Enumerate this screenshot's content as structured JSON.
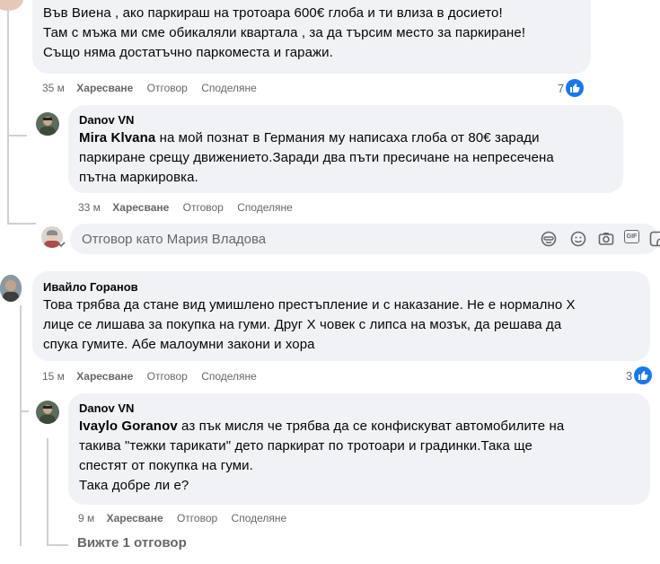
{
  "comment1": {
    "text_lines": [
      "Във Виена , ако паркираш на тротоара 600€ глоба и ти влиза в досието!",
      "Там с мъжа ми сме обикаляли квартала , за да търсим место за паркиране!",
      "Също няма достатъчно паркоместа и гаражи."
    ],
    "time": "35 м",
    "like": "Харесване",
    "reply": "Отговор",
    "share": "Споделяне",
    "reaction_count": "7"
  },
  "reply1": {
    "author": "Danov VN",
    "mention": "Mira Klvana",
    "text_lines": [
      " на мой познат в Германия му написаха глоба от 80€ заради",
      "паркиране срещу движението.Заради два пъти пресичане на непресечена",
      "пътна маркировка."
    ],
    "time": "33 м",
    "like": "Харесване",
    "reply": "Отговор",
    "share": "Споделяне"
  },
  "reply_box": {
    "placeholder": "Отговор като Мария Владова",
    "icons": [
      "sticker-icon",
      "emoji-icon",
      "camera-icon",
      "gif-icon",
      "sticker-square-icon"
    ],
    "gif_label": "GIF"
  },
  "comment2": {
    "author": "Ивайло Горанов",
    "text_lines": [
      "Това трябва да стане вид умишлено престъпление и с наказание. Не е нормално Х",
      "лице се лишава за покупка на гуми. Друг Х човек с липса на мозък, да решава да",
      "спука гумите. Абе малоумни закони и хора"
    ],
    "time": "15 м",
    "like": "Харесване",
    "reply": "Отговор",
    "share": "Споделяне",
    "reaction_count": "3"
  },
  "reply2": {
    "author": "Danov VN",
    "mention": "Ivaylo Goranov",
    "text_lines": [
      " аз пък мисля че трябва да се конфискуват автомобилите на",
      "такива \"тежки тарикати\" дето паркират по тротоари и градинки.Така ще",
      "спестят от покупка на гуми.",
      "Така добре ли е?"
    ],
    "time": "9 м",
    "like": "Харесване",
    "reply": "Отговор",
    "share": "Споделяне"
  },
  "view_replies": "Вижте 1 отговор",
  "colors": {
    "bubble": "#f0f2f5",
    "meta": "#65676b",
    "like_blue": "#1877f2",
    "thread_line": "#ced0d4"
  }
}
